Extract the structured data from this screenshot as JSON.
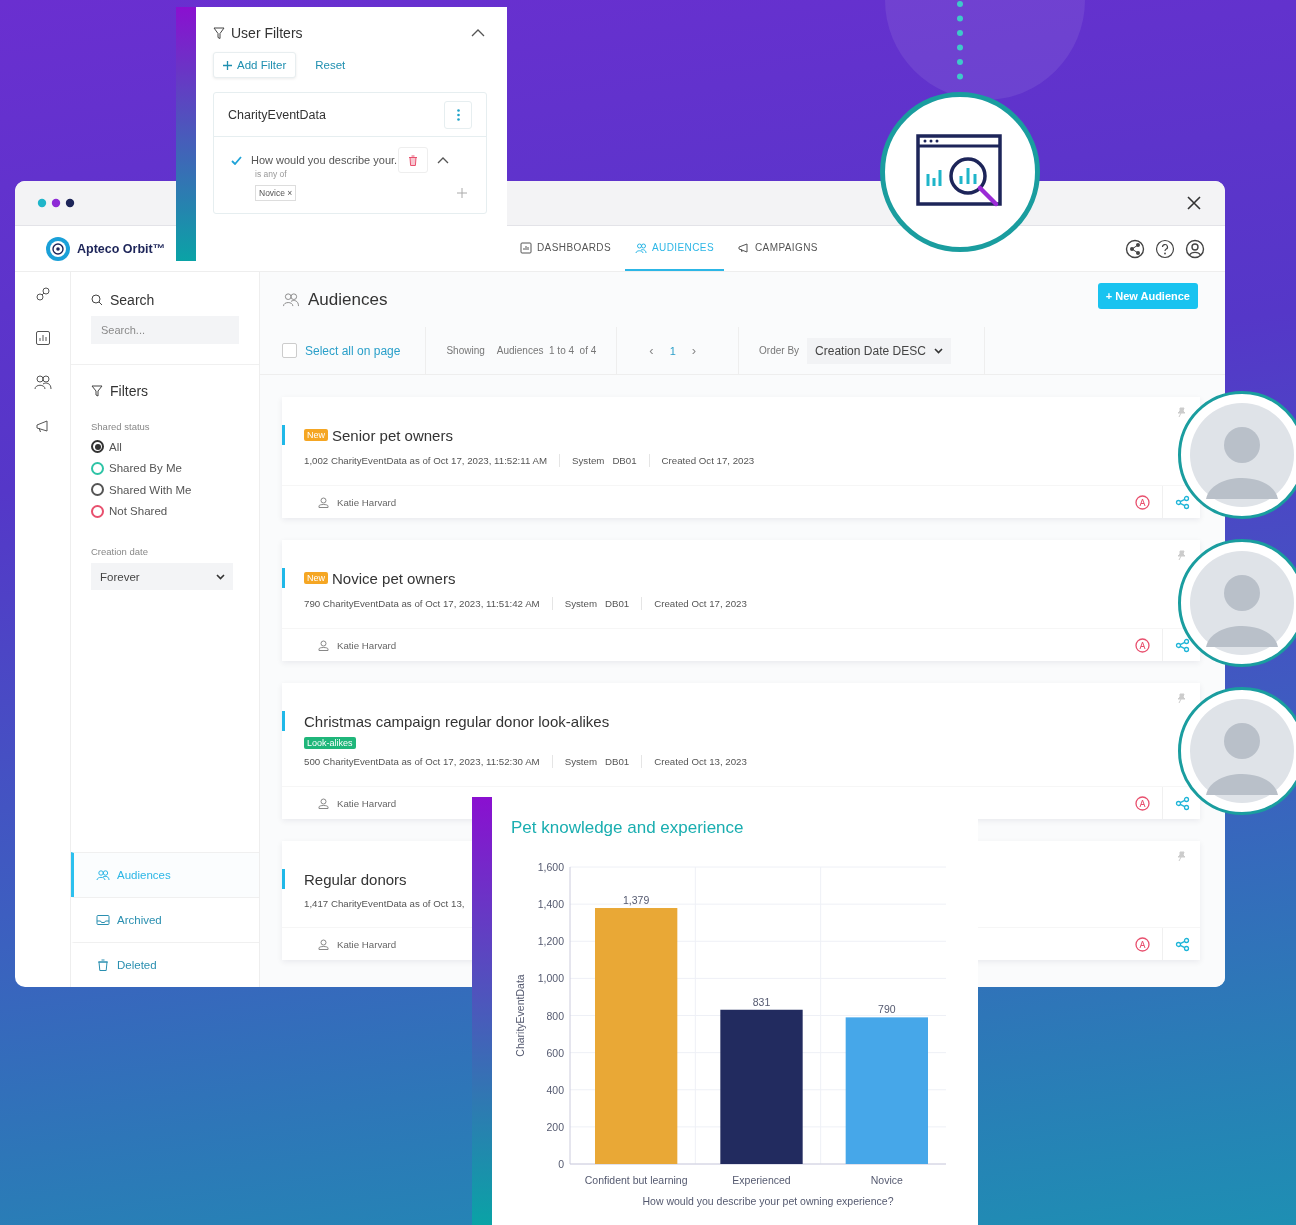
{
  "filter_panel": {
    "title": "User Filters",
    "add_filter": "Add Filter",
    "reset": "Reset",
    "group": {
      "name": "CharityEventData",
      "rule": {
        "checked": true,
        "question": "How would you describe your.",
        "operator": "is any of",
        "values": [
          "Novice ×"
        ]
      }
    }
  },
  "app": {
    "logo": "Apteco Orbit™",
    "nav": [
      {
        "label": "DASHBOARDS",
        "kind": "dashboards",
        "selected": false
      },
      {
        "label": "AUDIENCES",
        "kind": "audiences",
        "selected": true
      },
      {
        "label": "CAMPAIGNS",
        "kind": "campaigns",
        "selected": false
      }
    ]
  },
  "sidebar": {
    "search_label": "Search",
    "search_placeholder": "Search...",
    "filters_label": "Filters",
    "shared_status": {
      "label": "Shared status",
      "options": [
        {
          "label": "All",
          "selected": true,
          "color": "#333333"
        },
        {
          "label": "Shared By Me",
          "selected": false,
          "color": "#2ec4a6"
        },
        {
          "label": "Shared With Me",
          "selected": false,
          "color": "#555555"
        },
        {
          "label": "Not Shared",
          "selected": false,
          "color": "#e8506e"
        }
      ]
    },
    "creation_date": {
      "label": "Creation date",
      "value": "Forever"
    },
    "nav": [
      {
        "label": "Audiences",
        "kind": "audiences",
        "selected": true
      },
      {
        "label": "Archived",
        "kind": "archived",
        "selected": false
      },
      {
        "label": "Deleted",
        "kind": "deleted",
        "selected": false
      }
    ]
  },
  "page": {
    "title": "Audiences",
    "new_button": "+ New Audience",
    "select_all": {
      "label": "Select all on page",
      "checked": false
    },
    "showing_label": "Showing",
    "showing_value": "Audiences  1 to 4  of 4",
    "pager": {
      "prev": "‹",
      "page": "1",
      "next": "›"
    },
    "order_by_label": "Order By",
    "order_by_value": "Creation Date DESC"
  },
  "audiences": [
    {
      "title": "Senior pet owners",
      "badge": {
        "label": "New",
        "kind": "new"
      },
      "count_text": "1,002 CharityEventData as of Oct 17, 2023, 11:52:11 AM",
      "system_label": "System",
      "system": "DB01",
      "created": "Created Oct 17, 2023",
      "owner": "Katie Harvard"
    },
    {
      "title": "Novice pet owners",
      "badge": {
        "label": "New",
        "kind": "new"
      },
      "count_text": "790 CharityEventData as of Oct 17, 2023, 11:51:42 AM",
      "system_label": "System",
      "system": "DB01",
      "created": "Created Oct 17, 2023",
      "owner": "Katie Harvard"
    },
    {
      "title": "Christmas campaign regular donor look-alikes",
      "badge": {
        "label": "Look-alikes",
        "kind": "tag"
      },
      "count_text": "500 CharityEventData as of Oct 17, 2023, 11:52:30 AM",
      "system_label": "System",
      "system": "DB01",
      "created": "Created Oct 13, 2023",
      "owner": "Katie Harvard"
    },
    {
      "title": "Regular donors",
      "count_text": "1,417 CharityEventData as of Oct 13,",
      "owner": "Katie Harvard"
    }
  ],
  "chart_panel": {
    "title": "Pet knowledge and experience",
    "bars": [
      {
        "color": "#e9a836"
      },
      {
        "color": "#222b5f"
      },
      {
        "color": "#46a7e9"
      }
    ],
    "chart_data": {
      "type": "bar",
      "xlabel": "How would you describe your pet owning experience?",
      "ylabel": "CharityEventData",
      "categories": [
        "Confident but learning",
        "Experienced",
        "Novice"
      ],
      "series": [
        {
          "values": [
            1379,
            831,
            790
          ]
        }
      ],
      "ylim": [
        0,
        1600
      ],
      "yticks": [
        0,
        200,
        400,
        600,
        800,
        {
          "value": 1000,
          "label": "1,000"
        },
        {
          "value": 1200,
          "label": "1,200"
        },
        {
          "value": 1400,
          "label": "1,400"
        },
        {
          "value": 1600,
          "label": "1,600"
        }
      ],
      "grid": true,
      "value_labels": [
        "1,379",
        "831",
        "790"
      ]
    }
  }
}
